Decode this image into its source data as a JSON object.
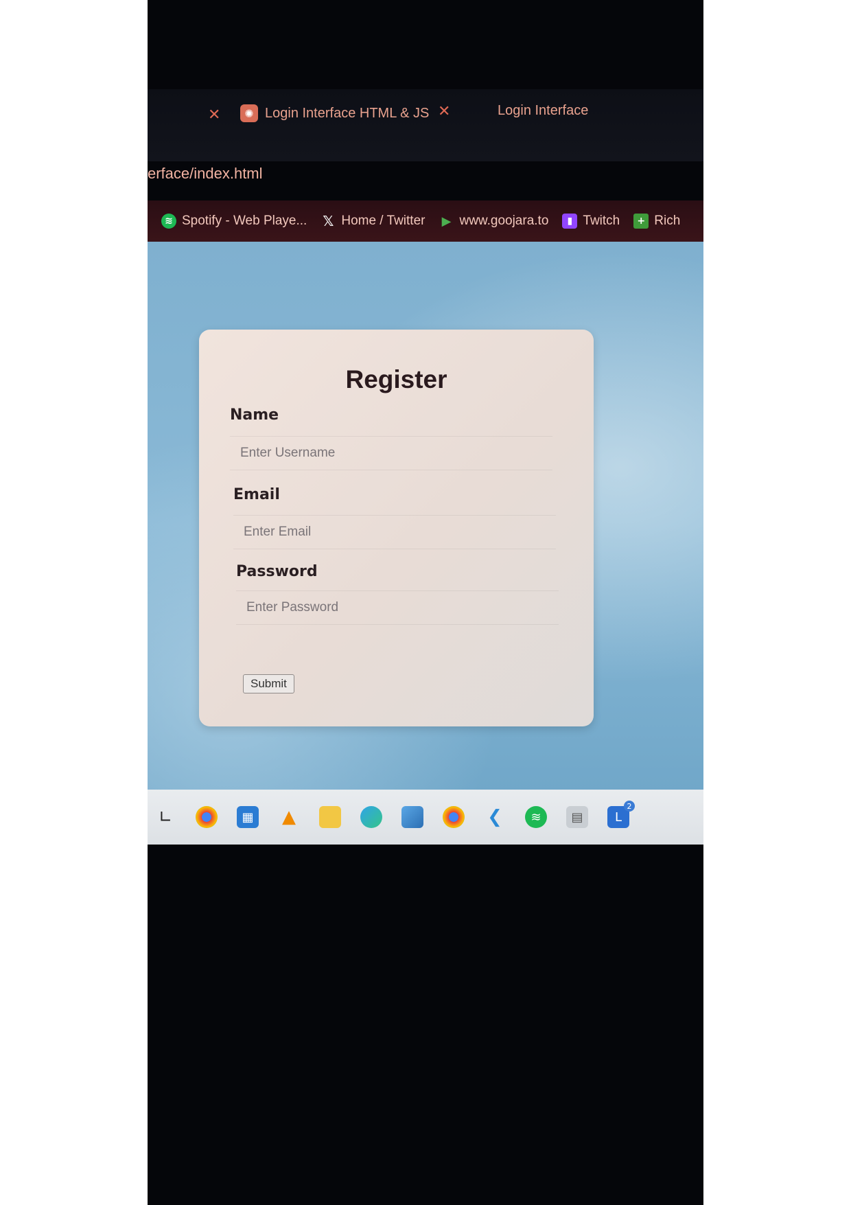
{
  "tabs": [
    {
      "label": "Login Interface HTML & JS",
      "favicon": "chatgpt-icon"
    },
    {
      "label": "Login Interface"
    }
  ],
  "address_bar": {
    "url_fragment": "erface/index.html"
  },
  "bookmarks": [
    {
      "label": "Spotify - Web Playe...",
      "icon": "spotify-icon",
      "color": "#1db954"
    },
    {
      "label": "Home / Twitter",
      "icon": "x-icon",
      "color": "#000000"
    },
    {
      "label": "www.goojara.to",
      "icon": "play-icon",
      "color": "#4caf50"
    },
    {
      "label": "Twitch",
      "icon": "twitch-icon",
      "color": "#9146ff"
    },
    {
      "label": "Rich",
      "icon": "plus-icon",
      "color": "#3f9b3a"
    }
  ],
  "form": {
    "title": "Register",
    "name_label": "Name",
    "name_placeholder": "Enter Username",
    "email_label": "Email",
    "email_placeholder": "Enter Email",
    "password_label": "Password",
    "password_placeholder": "Enter Password",
    "submit_label": "Submit"
  },
  "taskbar": {
    "apps": [
      "start-icon",
      "chrome-icon",
      "store-icon",
      "vlc-icon",
      "file-explorer-icon",
      "edge-icon",
      "photos-icon",
      "chrome-icon",
      "vscode-icon",
      "spotify-icon",
      "calculator-icon",
      "app-l-icon"
    ],
    "badge": "2"
  },
  "colors": {
    "accent": "#e06a55",
    "page_background": "#7fb0cf"
  }
}
